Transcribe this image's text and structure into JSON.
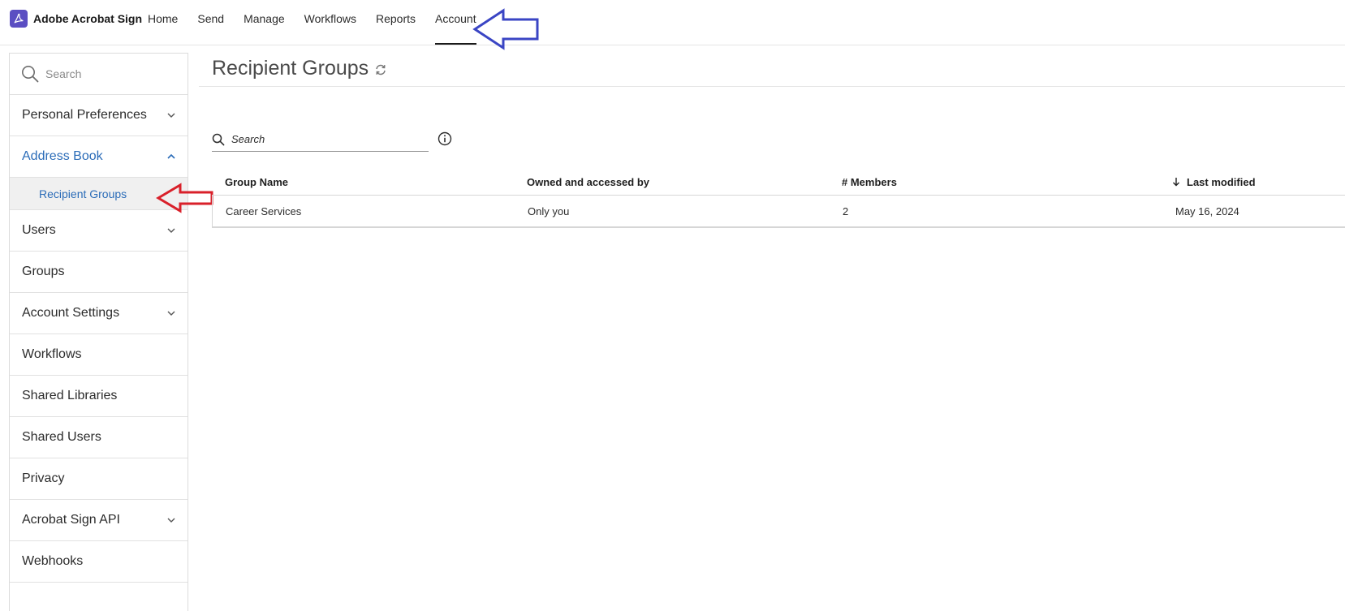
{
  "app": {
    "name": "Adobe Acrobat Sign",
    "brand_color": "#5b4ec2"
  },
  "nav": {
    "items": [
      {
        "label": "Home"
      },
      {
        "label": "Send"
      },
      {
        "label": "Manage"
      },
      {
        "label": "Workflows"
      },
      {
        "label": "Reports"
      },
      {
        "label": "Account",
        "active": true
      }
    ]
  },
  "sidebar": {
    "search_placeholder": "Search",
    "items": [
      {
        "label": "Personal Preferences",
        "icon": "chevron-down-icon"
      },
      {
        "label": "Address Book",
        "icon": "chevron-up-icon",
        "expanded": true
      },
      {
        "label": "Recipient Groups",
        "sub": true,
        "selected": true
      },
      {
        "label": "Users",
        "icon": "chevron-down-icon"
      },
      {
        "label": "Groups"
      },
      {
        "label": "Account Settings",
        "icon": "chevron-down-icon"
      },
      {
        "label": "Workflows"
      },
      {
        "label": "Shared Libraries"
      },
      {
        "label": "Shared Users"
      },
      {
        "label": "Privacy"
      },
      {
        "label": "Acrobat Sign API",
        "icon": "chevron-down-icon"
      },
      {
        "label": "Webhooks"
      }
    ]
  },
  "main": {
    "title": "Recipient Groups",
    "search_placeholder": "Search",
    "table": {
      "columns": [
        "Group Name",
        "Owned and accessed by",
        "# Members",
        "Last modified"
      ],
      "sorted_column": "Last modified",
      "sort_direction": "descending",
      "rows": [
        {
          "group_name": "Career Services",
          "owned_by": "Only you",
          "members": "2",
          "last_modified": "May 16, 2024"
        }
      ]
    }
  },
  "annotations": {
    "blue_arrow_color": "#3a45c4",
    "red_arrow_color": "#d9202a"
  },
  "colors": {
    "link_blue": "#2b6cb8",
    "border": "#dcdcdc"
  }
}
